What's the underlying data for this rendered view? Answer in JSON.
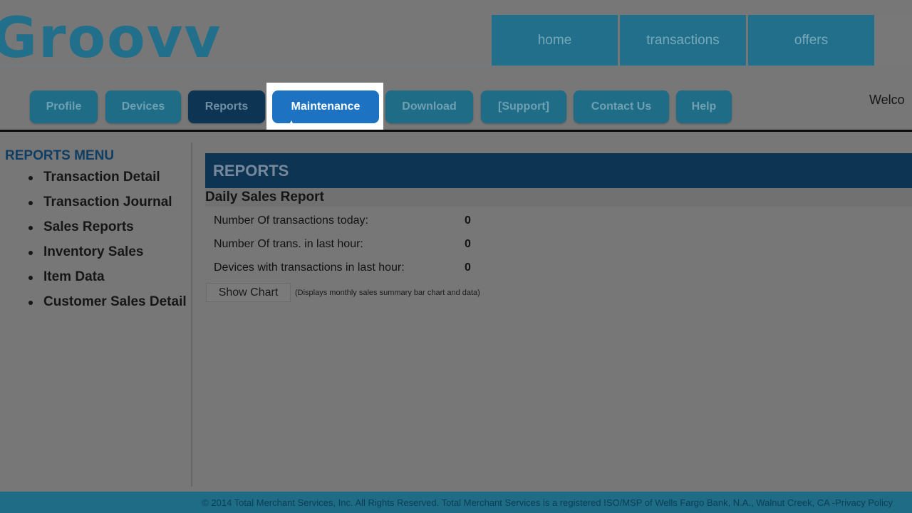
{
  "logo": {
    "text": "Groovv"
  },
  "top_nav": [
    "home",
    "transactions",
    "offers"
  ],
  "welcome_text": "Welco",
  "sub_nav": [
    {
      "label": "Profile",
      "state": "normal"
    },
    {
      "label": "Devices",
      "state": "normal"
    },
    {
      "label": "Reports",
      "state": "active"
    },
    {
      "label": "Maintenance",
      "state": "highlighted"
    },
    {
      "label": "Download",
      "state": "normal"
    },
    {
      "label": "[Support]",
      "state": "normal"
    },
    {
      "label": "Contact Us",
      "state": "normal"
    },
    {
      "label": "Help",
      "state": "normal"
    }
  ],
  "sidebar": {
    "title": "REPORTS MENU",
    "items": [
      "Transaction Detail",
      "Transaction Journal",
      "Sales Reports",
      "Inventory Sales",
      "Item Data",
      "Customer Sales Detail"
    ]
  },
  "main": {
    "header": "REPORTS",
    "subtitle": "Daily Sales Report",
    "stats": [
      {
        "label": "Number Of transactions today:",
        "value": "0"
      },
      {
        "label": "Number Of trans. in last hour:",
        "value": "0"
      },
      {
        "label": "Devices with transactions in last hour:",
        "value": "0"
      }
    ],
    "show_chart_label": "Show Chart",
    "show_chart_note": "(Displays monthly sales summary bar chart and data)"
  },
  "footer": {
    "text": "© 2014 Total Merchant Services, Inc. All Rights Reserved. Total Merchant Services is a registered ISO/MSP of Wells Fargo Bank, N.A., Walnut Creek, CA - ",
    "link": "Privacy Policy"
  },
  "colors": {
    "brand_teal": "#216f8b",
    "dark_navy": "#0d3553",
    "highlight_blue": "#1d73c1",
    "overlay_gray": "#777777"
  }
}
